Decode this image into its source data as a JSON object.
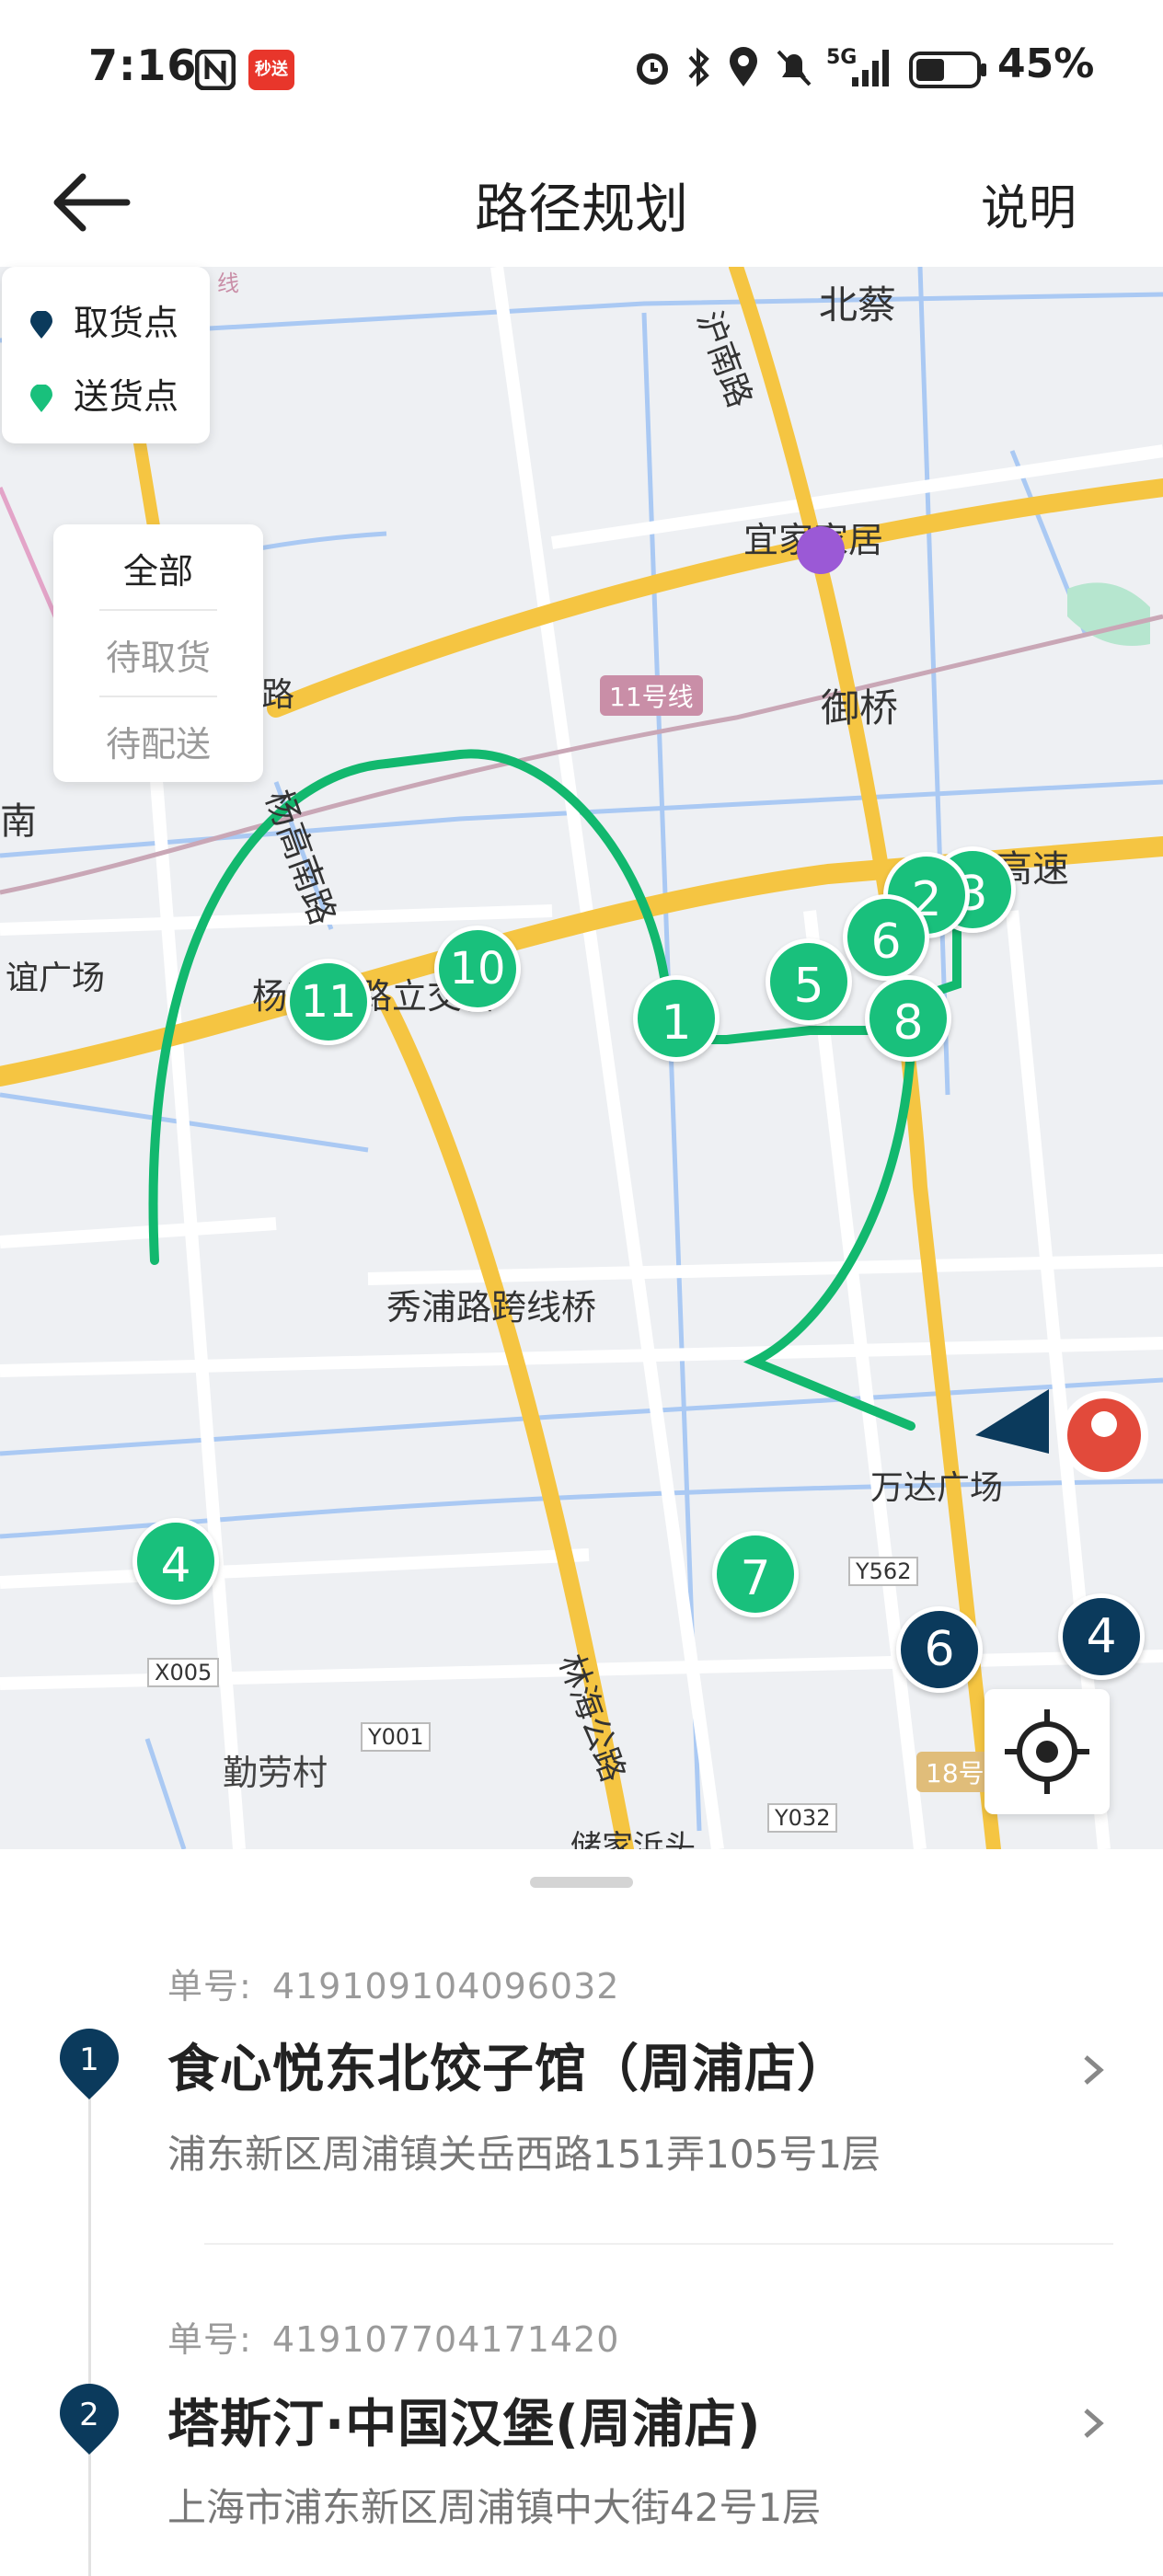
{
  "status_bar": {
    "time": "7:16",
    "app_badge": "秒送",
    "network": "5G",
    "battery": "45%"
  },
  "header": {
    "title": "路径规划",
    "help": "说明"
  },
  "legend": {
    "pickup": "取货点",
    "dropoff": "送货点"
  },
  "filter": {
    "all": "全部",
    "to_pickup": "待取货",
    "to_deliver": "待配送"
  },
  "map": {
    "labels": {
      "beicai": "北蔡",
      "hunan_rd": "沪南路",
      "ikea": "宜家家居",
      "yuqiao": "御桥",
      "line11": "11号线",
      "gaosu": "高速",
      "yanggao_interchange": "杨高南路立交桥",
      "yanggao_s": "杨高南路",
      "xiupu_bridge": "秀浦路跨线桥",
      "wanda": "万达广场",
      "linhai": "林海公路",
      "qinlao": "勤劳村",
      "y562": "Y562",
      "x005": "X005",
      "y001": "Y001",
      "y032": "Y032",
      "line18": "18号",
      "nan": "南",
      "yiguang": "谊广场",
      "lu": "路",
      "chujia": "储家浜头",
      "xian": "线"
    },
    "markers": {
      "m1": "1",
      "m2": "2",
      "m3": "3",
      "m4": "4",
      "m5": "5",
      "m6": "6",
      "m7": "7",
      "m8": "8",
      "m10": "10",
      "m11": "11",
      "p6": "6",
      "p4": "4"
    },
    "colors": {
      "route": "#12b86e",
      "pickup": "#0b3a5c",
      "dropoff": "#19c07c"
    }
  },
  "orders": [
    {
      "index": "1",
      "label": "单号:",
      "order_no": "419109104096032",
      "store": "食心悦东北饺子馆（周浦店）",
      "address": "浦东新区周浦镇关岳西路151弄105号1层"
    },
    {
      "index": "2",
      "label": "单号:",
      "order_no": "419107704171420",
      "store": "塔斯汀·中国汉堡(周浦店)",
      "address": "上海市浦东新区周浦镇中大街42号1层"
    }
  ]
}
